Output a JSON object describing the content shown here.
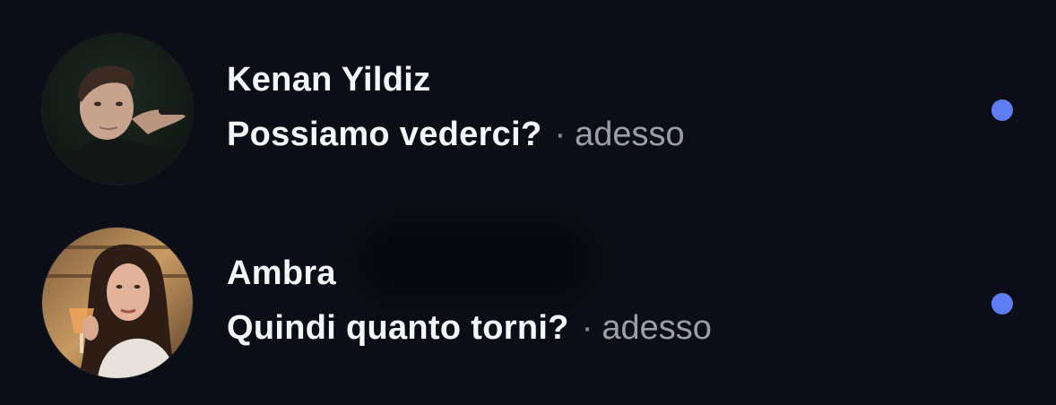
{
  "conversations": [
    {
      "name": "Kenan Yildiz",
      "message": "Possiamo vederci?",
      "separator": "·",
      "time": "adesso",
      "unread": true,
      "avatar_icon": "user-photo"
    },
    {
      "name": "Ambra",
      "message": "Quindi quanto torni?",
      "separator": "·",
      "time": "adesso",
      "unread": true,
      "avatar_icon": "user-photo"
    }
  ],
  "colors": {
    "background": "#0b0e16",
    "primary_text": "#f5f6f8",
    "secondary_text": "#9a9fa8",
    "unread_dot": "#5e7df2"
  }
}
